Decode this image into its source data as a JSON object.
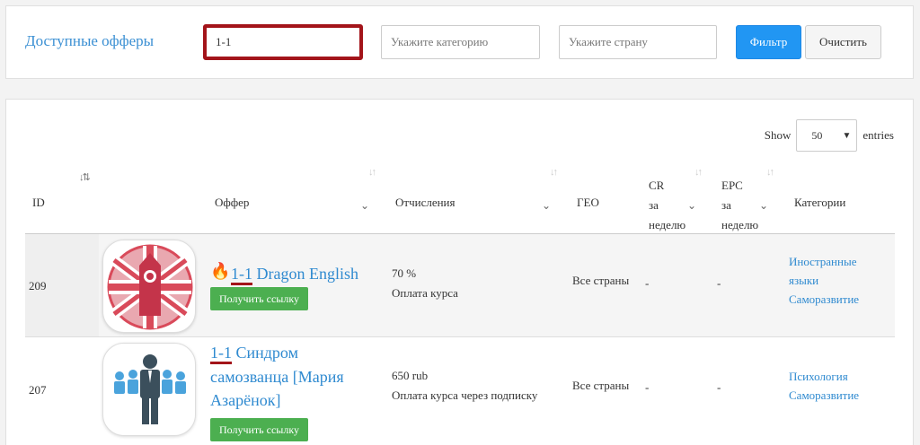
{
  "filter": {
    "title": "Доступные офферы",
    "search_value": "1-1",
    "category_placeholder": "Укажите категорию",
    "country_placeholder": "Укажите страну",
    "filter_label": "Фильтр",
    "clear_label": "Очистить"
  },
  "table": {
    "show_label": "Show",
    "entries_value": "50",
    "entries_label": "entries",
    "headers": {
      "id": "ID",
      "offer": "Оффер",
      "payout": "Отчисления",
      "geo": "ГЕО",
      "cr_1": "CR",
      "cr_2": "за",
      "cr_3": "неделю",
      "epc_1": "EPC",
      "epc_2": "за",
      "epc_3": "неделю",
      "categories": "Категории"
    },
    "rows": [
      {
        "id": "209",
        "title_highlight": "1-1",
        "title_rest": " Dragon English",
        "button": "Получить ссылку",
        "payout_value": "70 %",
        "payout_desc": "Оплата курса",
        "geo": "Все страны",
        "cr": "-",
        "epc": "-",
        "category_1": "Иностранные",
        "category_2": "языки",
        "category_3": "Саморазвитие"
      },
      {
        "id": "207",
        "title_highlight": "1-1",
        "title_rest_1": " Синдром",
        "title_rest_2": "самозванца [Мария",
        "title_rest_3": "Азарёнок]",
        "button": "Получить ссылку",
        "payout_value": "650 rub",
        "payout_desc": "Оплата курса через подписку",
        "geo": "Все страны",
        "cr": "-",
        "epc": "-",
        "category_1": "Психология",
        "category_2": "Саморазвитие"
      }
    ]
  },
  "colors": {
    "accent": "#2196f3",
    "link": "#2f8ad0",
    "success": "#4caf50",
    "highlight": "#a3141a"
  }
}
